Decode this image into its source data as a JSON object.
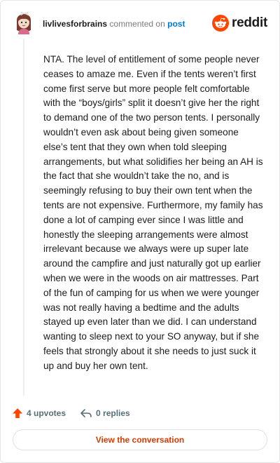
{
  "comment": {
    "username": "livlivesforbrains",
    "verb": "commented on",
    "target": "post",
    "body": "NTA. The level of entitlement of some people never ceases to amaze me. Even if the tents weren’t first come first serve but more people felt comfortable with the “boys/girls” split it doesn’t give her the right to demand one of the two person tents. I personally wouldn’t even ask about being given someone else’s tent that they own when told sleeping arrangements, but what solidifies her being an AH is the fact that she wouldn’t take the no, and is seemingly refusing to buy their own tent when the tents are not expensive. Furthermore, my family has done a lot of camping ever since I was little and honestly the sleeping arrangements were almost irrelevant because we always were up super late around the campfire and just naturally got up earlier when we were in the woods on air mattresses. Part of the fun of camping for us when we were younger was not really having a bedtime and the adults stayed up even later than we did. I can understand wanting to sleep next to your SO anyway, but if she feels that strongly about it she needs to just suck it up and buy her own tent.",
    "upvotes": "4 upvotes",
    "replies": "0 replies"
  },
  "brand": {
    "name": "reddit",
    "color": "#ff4500"
  },
  "actions": {
    "view_conversation": "View the conversation"
  },
  "icons": {
    "avatar": "user-avatar-icon",
    "logo": "reddit-logo-icon",
    "upvote": "upvote-arrow-icon",
    "reply": "reply-arrow-icon"
  },
  "colors": {
    "link": "#0079d3",
    "accent": "#d93a00",
    "upvote": "#ff4500"
  }
}
